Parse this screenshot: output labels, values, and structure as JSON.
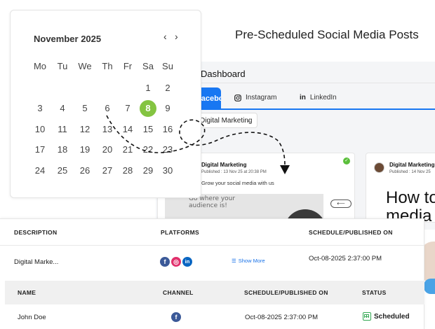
{
  "page": {
    "title": "Pre-Scheduled Social Media Posts"
  },
  "dashboard": {
    "title": "Dashboard",
    "tabs": [
      {
        "label": "Facebook",
        "active": true
      },
      {
        "label": "Instagram",
        "icon": "instagram-icon"
      },
      {
        "label": "LinkedIn",
        "icon": "linkedin-icon"
      }
    ],
    "account_select": "Digital Marketing",
    "posts": [
      {
        "name": "Digital Marketing",
        "date": "Published : 13 Nov 25 at 20:38 PM",
        "text": "Grow your social media with us",
        "image_text": "Go where your audience is!"
      },
      {
        "name": "Digital Marketing",
        "date": "Published : 14 Nov 25",
        "image_text": "How to media"
      }
    ]
  },
  "calendar": {
    "month": "November 2025",
    "weekdays": [
      "Mo",
      "Tu",
      "We",
      "Th",
      "Fr",
      "Sa",
      "Su"
    ],
    "weeks": [
      [
        "",
        "",
        "",
        "",
        "",
        "1",
        "2"
      ],
      [
        "3",
        "4",
        "5",
        "6",
        "7",
        "8",
        "9"
      ],
      [
        "10",
        "11",
        "12",
        "13",
        "14",
        "15",
        "16"
      ],
      [
        "17",
        "18",
        "19",
        "20",
        "21",
        "22",
        "23"
      ],
      [
        "24",
        "25",
        "26",
        "27",
        "28",
        "29",
        "30"
      ]
    ],
    "selected": "8"
  },
  "scheduled_table": {
    "headers": {
      "description": "DESCRIPTION",
      "platforms": "PLATFORMS",
      "schedule": "SCHEDULE/PUBLISHED ON"
    },
    "row": {
      "description": "Digital Marke...",
      "show_more": "Show More",
      "schedule": "Oct-08-2025 2:37:00 PM",
      "platforms": [
        "facebook",
        "instagram",
        "linkedin"
      ]
    }
  },
  "channel_table": {
    "headers": {
      "name": "NAME",
      "channel": "CHANNEL",
      "schedule": "SCHEDULE/PUBLISHED ON",
      "status": "STATUS"
    },
    "row": {
      "name": "John Doe",
      "channel": "facebook",
      "schedule": "Oct-08-2025 2:37:00 PM",
      "status": "Scheduled"
    }
  },
  "colors": {
    "accent": "#1877f2",
    "selected_day": "#84c441",
    "status": "#34a853"
  }
}
